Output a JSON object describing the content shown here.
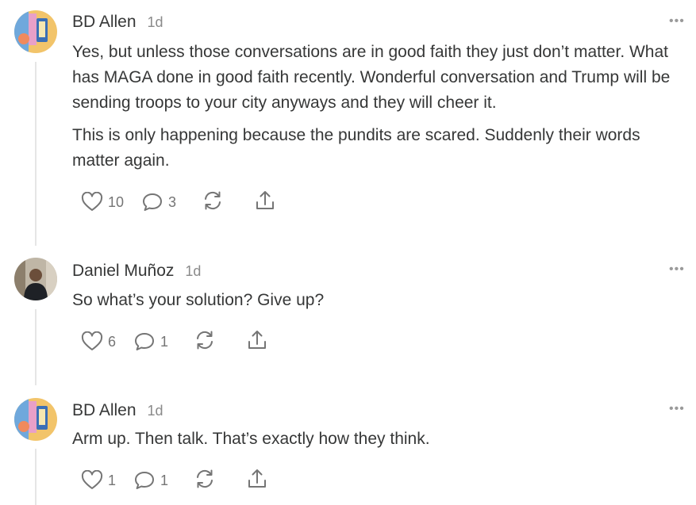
{
  "comments": [
    {
      "author": "BD Allen",
      "time": "1d",
      "more": "•••",
      "paragraphs": [
        "Yes, but unless those conversations are in good faith they just don’t matter. What has MAGA done in good faith recently. Wonderful conversation and Trump will be sending troops to your city anyways and they will cheer it.",
        "This is only happening because the pundits are scared. Suddenly their words matter again."
      ],
      "likes": "10",
      "replies": "3",
      "icons": [
        "heart-icon",
        "comment-icon",
        "restack-icon",
        "share-icon"
      ]
    },
    {
      "author": "Daniel Muñoz",
      "time": "1d",
      "more": "•••",
      "paragraphs": [
        "So what’s your solution? Give up?"
      ],
      "likes": "6",
      "replies": "1",
      "icons": [
        "heart-icon",
        "comment-icon",
        "restack-icon",
        "share-icon"
      ]
    },
    {
      "author": "BD Allen",
      "time": "1d",
      "more": "•••",
      "paragraphs": [
        "Arm up. Then talk. That’s exactly how they think."
      ],
      "likes": "1",
      "replies": "1",
      "icons": [
        "heart-icon",
        "comment-icon",
        "restack-icon",
        "share-icon"
      ]
    }
  ],
  "colors": {
    "text": "#363737",
    "muted": "#8a8a8a",
    "icon": "#757575",
    "thread_line": "#e6e6e6"
  }
}
